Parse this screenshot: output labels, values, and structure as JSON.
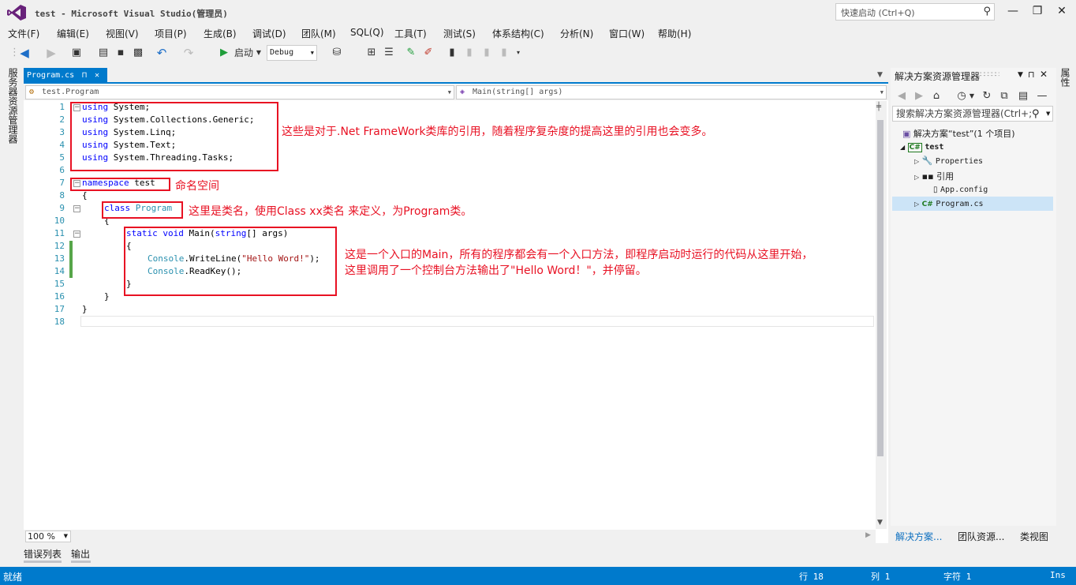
{
  "window": {
    "title": "test - Microsoft Visual Studio(管理员)",
    "quick_launch_placeholder": "快速启动 (Ctrl+Q)",
    "minimize": "—",
    "restore": "❐",
    "close": "✕"
  },
  "menu": [
    "文件(F)",
    "编辑(E)",
    "视图(V)",
    "项目(P)",
    "生成(B)",
    "调试(D)",
    "团队(M)",
    "SQL(Q)",
    "工具(T)",
    "测试(S)",
    "体系结构(C)",
    "分析(N)",
    "窗口(W)",
    "帮助(H)"
  ],
  "toolbar": {
    "start_label": "启动",
    "configuration": "Debug"
  },
  "left_panel_label": "服务器资源管理器",
  "right_panel_label": "属性",
  "editor": {
    "tab_label": "Program.cs",
    "tab_pin": "⊓",
    "tab_close": "✕",
    "nav_left": "test.Program",
    "nav_right": "Main(string[] args)",
    "zoom": "100 %",
    "line_numbers": [
      "1",
      "2",
      "3",
      "4",
      "5",
      "6",
      "7",
      "8",
      "9",
      "10",
      "11",
      "12",
      "13",
      "14",
      "15",
      "16",
      "17",
      "18"
    ],
    "lines": [
      {
        "kw": "using",
        "rest": " System;"
      },
      {
        "kw": "using",
        "rest": " System.Collections.Generic;"
      },
      {
        "kw": "using",
        "rest": " System.Linq;"
      },
      {
        "kw": "using",
        "rest": " System.Text;"
      },
      {
        "kw": "using",
        "rest": " System.Threading.Tasks;"
      }
    ],
    "line7_kw": "namespace",
    "line7_rest": " test",
    "line8": "{",
    "line9_kw": "class",
    "line9_type": "Program",
    "line10": "{",
    "line11_kw1": "static",
    "line11_kw2": "void",
    "line11_name": " Main(",
    "line11_kw3": "string",
    "line11_rest": "[] args)",
    "line12": "{",
    "line13_type": "Console",
    "line13_call": ".WriteLine(",
    "line13_str": "\"Hello Word!\"",
    "line13_end": ");",
    "line14_type": "Console",
    "line14_call": ".ReadKey();",
    "line15": "}",
    "line16": "}",
    "line17": "}"
  },
  "annotations": {
    "using_note": "这些是对于.Net FrameWork类库的引用，随着程序复杂度的提高这里的引用也会变多。",
    "namespace_note": "命名空间",
    "class_note": "这里是类名，使用Class xx类名 来定义，为Program类。",
    "main_note_line1": "这是一个入口的Main，所有的程序都会有一个入口方法，即程序启动时运行的代码从这里开始，",
    "main_note_line2": "这里调用了一个控制台方法输出了\"Hello Word！\"，并停留。"
  },
  "bottom_tabs": [
    "错误列表",
    "输出"
  ],
  "solution_explorer": {
    "title": "解决方案资源管理器",
    "search_placeholder": "搜索解决方案资源管理器(Ctrl+;)",
    "solution": "解决方案“test”(1 个项目)",
    "project": "test",
    "items": [
      "Properties",
      "引用",
      "App.config",
      "Program.cs"
    ],
    "tabs": [
      "解决方案...",
      "团队资源...",
      "类视图"
    ]
  },
  "status": {
    "ready": "就绪",
    "line": "行 18",
    "col": "列 1",
    "char": "字符 1",
    "mode": "Ins"
  }
}
